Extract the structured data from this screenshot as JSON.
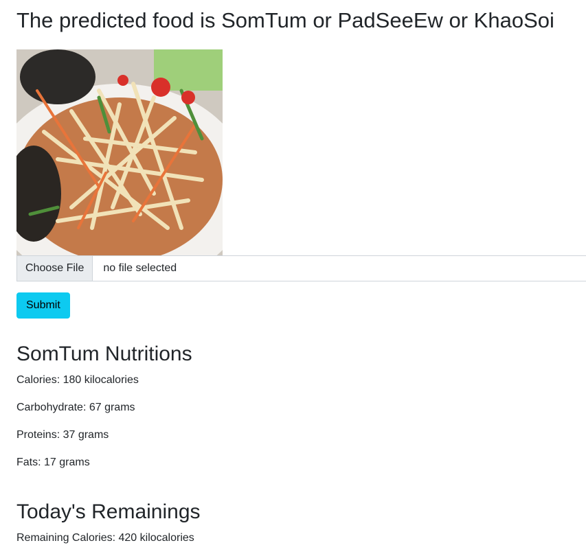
{
  "page": {
    "title": "The predicted food is SomTum or PadSeeEw or KhaoSoi"
  },
  "upload": {
    "choose_file_label": "Choose File",
    "file_status": "no file selected",
    "submit_label": "Submit"
  },
  "nutrition": {
    "heading": "SomTum Nutritions",
    "calories": "Calories: 180 kilocalories",
    "carbohydrate": "Carbohydrate: 67 grams",
    "proteins": "Proteins: 37 grams",
    "fats": "Fats: 17 grams"
  },
  "remaining": {
    "heading": "Today's Remainings",
    "calories": "Remaining Calories: 420 kilocalories"
  },
  "colors": {
    "submit_button": "#0dcaf0",
    "file_button_bg": "#e9ecef",
    "text": "#212529"
  }
}
